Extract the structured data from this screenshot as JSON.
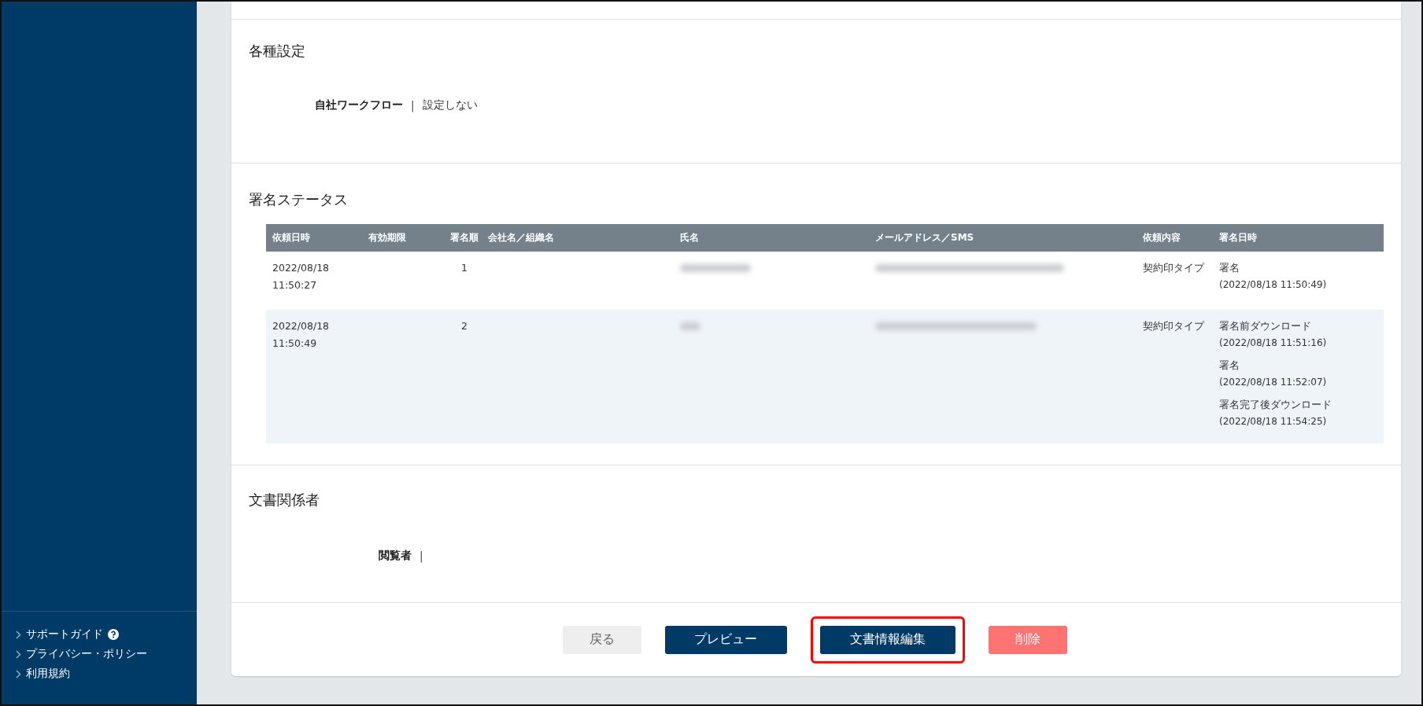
{
  "sidebar": {
    "links": [
      {
        "label": "サポートガイド",
        "help_icon": true
      },
      {
        "label": "プライバシー・ポリシー",
        "help_icon": false
      },
      {
        "label": "利用規約",
        "help_icon": false
      }
    ]
  },
  "settings": {
    "title": "各種設定",
    "fields": [
      {
        "label": "自社ワークフロー",
        "separator": "|",
        "value": "設定しない"
      }
    ]
  },
  "signature_status": {
    "title": "署名ステータス",
    "table": {
      "columns": [
        "依頼日時",
        "有効期限",
        "署名順",
        "会社名／組織名",
        "氏名",
        "メールアドレス／SMS",
        "依頼内容",
        "署名日時"
      ],
      "rows": [
        {
          "requested": [
            "2022/08/18",
            "11:50:27"
          ],
          "order": "1",
          "name_redacted": true,
          "email_redacted": true,
          "request_type": "契約印タイプ",
          "events": [
            {
              "action": "署名",
              "time": "(2022/08/18 11:50:49)"
            }
          ]
        },
        {
          "requested": [
            "2022/08/18",
            "11:50:49"
          ],
          "order": "2",
          "name_redacted": true,
          "email_redacted": true,
          "request_type": "契約印タイプ",
          "events": [
            {
              "action": "署名前ダウンロード",
              "time": "(2022/08/18 11:51:16)"
            },
            {
              "action": "署名",
              "time": "(2022/08/18 11:52:07)"
            },
            {
              "action": "署名完了後ダウンロード",
              "time": "(2022/08/18 11:54:25)"
            }
          ]
        }
      ]
    }
  },
  "document_parties": {
    "title": "文書関係者",
    "fields": [
      {
        "label": "閲覧者",
        "separator": "|"
      }
    ]
  },
  "buttons": [
    {
      "label": "戻る",
      "kind": "back",
      "highlighted": false
    },
    {
      "label": "プレビュー",
      "kind": "primary",
      "highlighted": false
    },
    {
      "label": "文書情報編集",
      "kind": "primary",
      "highlighted": true
    },
    {
      "label": "削除",
      "kind": "danger",
      "highlighted": false
    }
  ]
}
